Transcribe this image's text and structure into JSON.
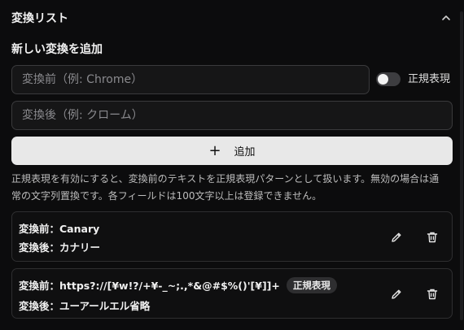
{
  "section": {
    "title": "変換リスト"
  },
  "form": {
    "title": "新しい変換を追加",
    "before_placeholder": "変換前（例: Chrome）",
    "after_placeholder": "変換後（例: クローム）",
    "regex_toggle_label": "正規表現",
    "regex_toggle_on": false,
    "add_button_label": "追加",
    "help_text_line1": "正規表現を有効にすると、変換前のテキストを正規表現パターンとして扱います。無効の場合は通",
    "help_text_line2": "常の文字列置換です。各フィールドは100文字以上は登録できません。"
  },
  "rules": [
    {
      "before": "変換前：Canary",
      "after": "変換後：カナリー",
      "regex": false
    },
    {
      "before": "変換前：https?://[¥w!?/+¥-_~;.,*&@#$%()'[¥]]+",
      "after": "変換後：ユーアールエル省略",
      "regex": true,
      "badge": "正規表現"
    }
  ]
}
